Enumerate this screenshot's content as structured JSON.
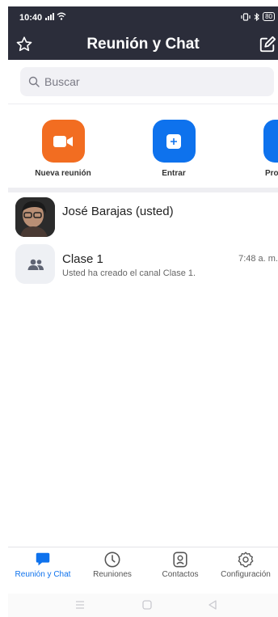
{
  "status_bar": {
    "time": "10:40",
    "battery": "80"
  },
  "header": {
    "title": "Reunión y Chat"
  },
  "search": {
    "placeholder": "Buscar"
  },
  "actions": [
    {
      "label": "Nueva reunión",
      "icon": "video-camera-icon",
      "color": "#f26d21"
    },
    {
      "label": "Entrar",
      "icon": "plus-icon",
      "color": "#0e72ed"
    },
    {
      "label": "Pro",
      "icon": "schedule-icon",
      "color": "#0e72ed"
    }
  ],
  "contacts": [
    {
      "name": "José Barajas (usted)"
    },
    {
      "name": "Clase 1",
      "subtitle": "Usted ha creado el canal Clase 1.",
      "time": "7:48 a. m."
    }
  ],
  "bottom_nav": [
    {
      "label": "Reunión y Chat",
      "icon": "chat-bubble-icon",
      "active": true
    },
    {
      "label": "Reuniones",
      "icon": "clock-icon",
      "active": false
    },
    {
      "label": "Contactos",
      "icon": "contact-card-icon",
      "active": false
    },
    {
      "label": "Configuración",
      "icon": "gear-icon",
      "active": false
    }
  ],
  "colors": {
    "header_bg": "#2b2d3a",
    "accent_blue": "#0e72ed",
    "accent_orange": "#f26d21"
  }
}
